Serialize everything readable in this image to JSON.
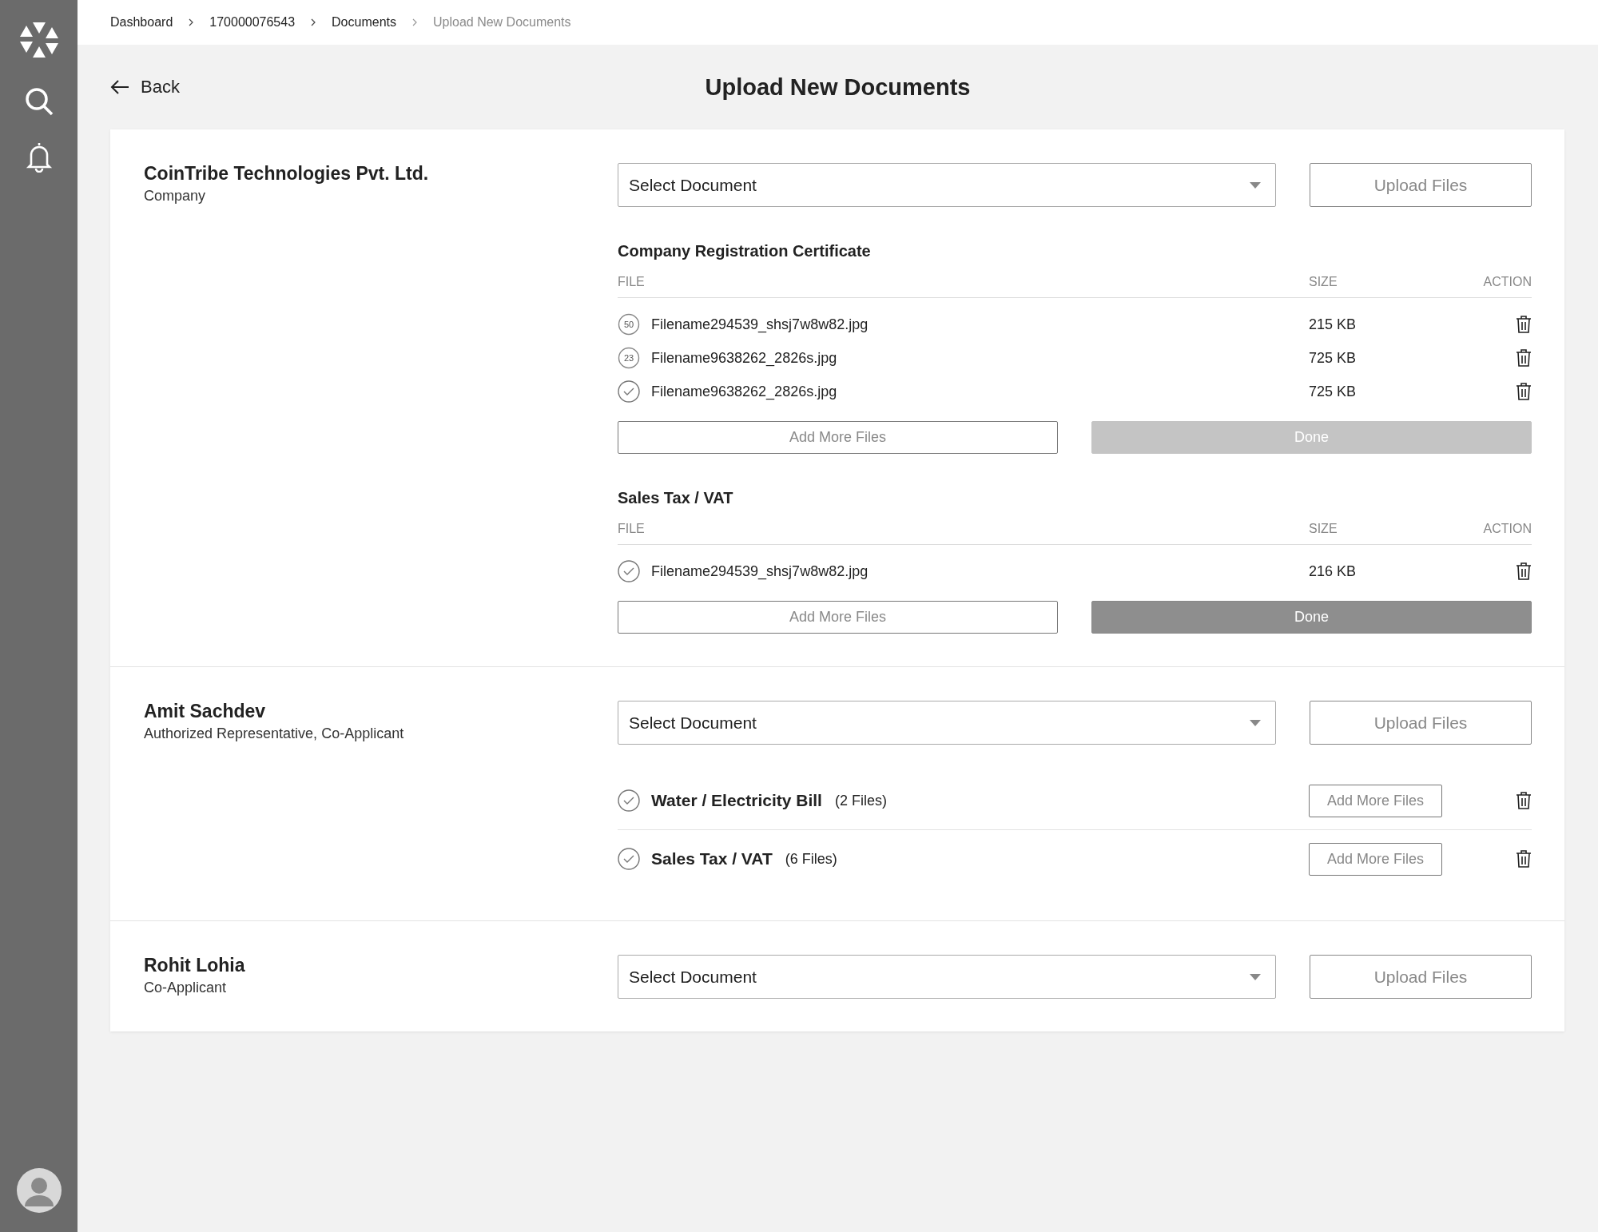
{
  "breadcrumb": [
    {
      "label": "Dashboard",
      "current": false
    },
    {
      "label": "170000076543",
      "current": false
    },
    {
      "label": "Documents",
      "current": false
    },
    {
      "label": "Upload New Documents",
      "current": true
    }
  ],
  "back": "Back",
  "title": "Upload New Documents",
  "sections": [
    {
      "name": "CoinTribe Technologies Pvt. Ltd.",
      "role": "Company",
      "select": {
        "placeholder": "Select Document"
      },
      "upload": "Upload Files",
      "groups": [
        {
          "title": "Company Registration Certificate",
          "columns": [
            "FILE",
            "SIZE",
            "ACTION"
          ],
          "files": [
            {
              "status": {
                "kind": "progress",
                "text": "50"
              },
              "name": "Filename294539_shsj7w8w82.jpg",
              "size": "215 KB"
            },
            {
              "status": {
                "kind": "progress",
                "text": "23"
              },
              "name": "Filename9638262_2826s.jpg",
              "size": "725 KB"
            },
            {
              "status": {
                "kind": "done"
              },
              "name": "Filename9638262_2826s.jpg",
              "size": "725 KB"
            }
          ],
          "add": "Add More Files",
          "done": {
            "label": "Done",
            "disabled": true
          }
        },
        {
          "title": "Sales Tax / VAT",
          "columns": [
            "FILE",
            "SIZE",
            "ACTION"
          ],
          "files": [
            {
              "status": {
                "kind": "done"
              },
              "name": "Filename294539_shsj7w8w82.jpg",
              "size": "216 KB"
            }
          ],
          "add": "Add More Files",
          "done": {
            "label": "Done",
            "disabled": false
          }
        }
      ]
    },
    {
      "name": "Amit Sachdev",
      "role": "Authorized Representative, Co-Applicant",
      "select": {
        "placeholder": "Select Document"
      },
      "upload": "Upload Files",
      "documents": [
        {
          "title": "Water / Electricity Bill",
          "count": "(2 Files)",
          "add": "Add More Files"
        },
        {
          "title": "Sales Tax / VAT",
          "count": "(6 Files)",
          "add": "Add More Files"
        }
      ]
    },
    {
      "name": "Rohit Lohia",
      "role": "Co-Applicant",
      "select": {
        "placeholder": "Select Document"
      },
      "upload": "Upload Files"
    }
  ]
}
